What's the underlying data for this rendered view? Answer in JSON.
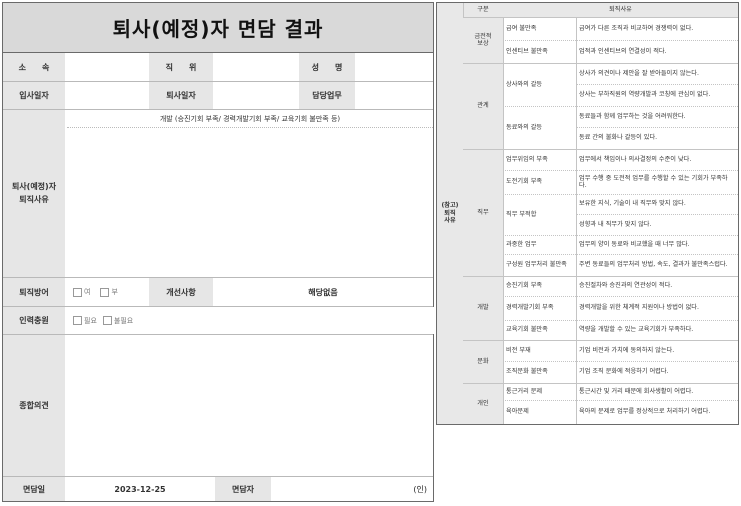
{
  "form": {
    "title": "퇴사(예정)자 면담 결과",
    "labels": {
      "affiliation": "소　　속",
      "position": "직　　위",
      "name": "성　　명",
      "hire_date": "입사일자",
      "leave_date": "퇴사일자",
      "duty": "담당업무",
      "reason": "퇴사(예정)자\n퇴직사유",
      "retention": "퇴직방어",
      "improvement": "개선사항",
      "staffing": "인력충원",
      "opinion": "종합의견",
      "interview_date": "면담일",
      "interviewer": "면담자"
    },
    "reason_hint": "개발 (승진기회 부족/ 경력개발기회 부족/ 교육기회 불만족 등)",
    "retention_options": [
      "여",
      "부"
    ],
    "improvement_value": "해당없음",
    "staffing_options": [
      "필요",
      "불필요"
    ],
    "interview_date_value": "2023-12-25",
    "seal": "(인)"
  },
  "ref": {
    "header": {
      "col1": "구분",
      "col2": "퇴직사유"
    },
    "side_label": "(참고)\n퇴직\n사유",
    "categories": [
      {
        "name": "금전적\n보상",
        "items": [
          {
            "sub": "급여 불만족",
            "text": "급여가 다른 조직과 비교하여 경쟁력이 없다."
          },
          {
            "sub": "인센티브 불만족",
            "text": "업적과 인센티브의 연결성이 적다."
          }
        ]
      },
      {
        "name": "관계",
        "items": [
          {
            "sub": "상사와의 갈등",
            "texts": [
              "상사가 의견이나 제안을 잘 받아들이지 않는다.",
              "상사는 부하직원의 역량개발과 코칭에 관심이 없다."
            ]
          },
          {
            "sub": "동료와의 갈등",
            "texts": [
              "동료들과 함께 업무하는 것을 어려워한다.",
              "동료 간의 불화나 갈등이 있다."
            ]
          }
        ]
      },
      {
        "name": "직무",
        "items": [
          {
            "sub": "업무위임의 부족",
            "text": "업무에서 책임이나 의사결정의 수준이 낮다."
          },
          {
            "sub": "도전기회 부족",
            "text": "업무 수행 중 도전적 업무를 수행할 수 있는 기회가 부족하다."
          },
          {
            "sub": "직무 부적합",
            "texts": [
              "보유한 지식, 기술이 내 직무와 맞지 않다.",
              "성향과 내 직무가 맞지 않다."
            ]
          },
          {
            "sub": "과중한 업무",
            "text": "업무의 양이 동료와 비교했을 때 너무 많다."
          },
          {
            "sub": "구성원 업무처리 불만족",
            "text": "주변 동료들의 업무처리 방법, 속도, 결과가 불만족스럽다."
          }
        ]
      },
      {
        "name": "개발",
        "items": [
          {
            "sub": "승진기회 부족",
            "text": "승진절차와 승진과의 연관성이 적다."
          },
          {
            "sub": "경력개발기회 부족",
            "text": "경력개발을 위한 체계적 지원이나 방법이 없다."
          },
          {
            "sub": "교육기회 불만족",
            "text": "역량을 개발할 수 있는 교육기회가 부족하다."
          }
        ]
      },
      {
        "name": "문화",
        "items": [
          {
            "sub": "비전 부재",
            "text": "기업 비전과 가치에 동의하지 않는다."
          },
          {
            "sub": "조직문화 불만족",
            "text": "기업 조직 문화에 적응하기 어렵다."
          }
        ]
      },
      {
        "name": "개인",
        "items": [
          {
            "sub": "통근거리 문제",
            "text": "통근시간 및 거리 때문에 회사생활이 어렵다."
          },
          {
            "sub": "육아문제",
            "text": "육아의 문제로 업무를 정상적으로 처리하기 어렵다."
          }
        ]
      }
    ]
  }
}
